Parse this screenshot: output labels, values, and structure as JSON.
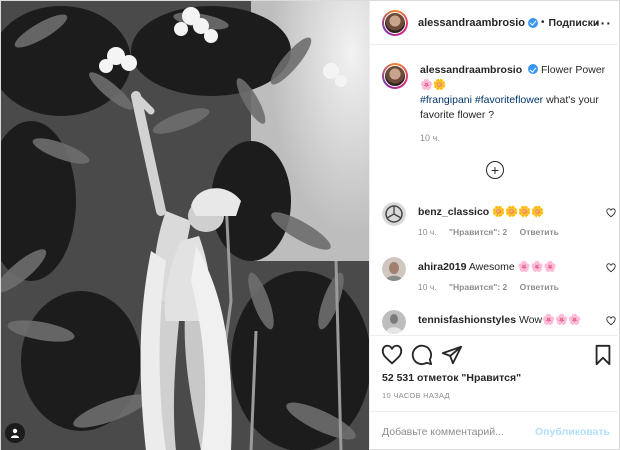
{
  "post": {
    "author": "alessandraambrosio",
    "header_separator": "•",
    "follow_label": "Подписки",
    "more_icon": "more-horizontal-icon",
    "image_alt": "Black and white photo of a woman reaching up to frangipani flowers"
  },
  "caption": {
    "user": "alessandraambrosio",
    "text_line1": "Flower Power",
    "emojis": "🌸🌼",
    "hashtag1": "#frangipani",
    "hashtag2": "#favoriteflower",
    "text_line2": "what's your favorite flower ?",
    "time": "10 ч."
  },
  "load_more_icon": "plus-circle-icon",
  "comments": [
    {
      "user": "benz_classico",
      "text": "🌼🌼🌼🌼",
      "time": "10 ч.",
      "likes": "\"Нравится\": 2",
      "reply": "Ответить"
    },
    {
      "user": "ahira2019",
      "text": "Awesome 🌸🌸🌸",
      "time": "10 ч.",
      "likes": "\"Нравится\": 2",
      "reply": "Ответить"
    },
    {
      "user": "tennisfashionstyles",
      "text": "Wow🌸🌸🌸",
      "time": "",
      "likes": "",
      "reply": ""
    }
  ],
  "actions": {
    "like_icon": "heart-icon",
    "comment_icon": "comment-icon",
    "share_icon": "share-icon",
    "save_icon": "bookmark-icon",
    "likes_text": "52 531 отметок \"Нравится\"",
    "time_ago": "10 ЧАСОВ НАЗАД"
  },
  "comment_input": {
    "placeholder": "Добавьте комментарий...",
    "publish_label": "Опубликовать"
  },
  "colors": {
    "link": "#003569",
    "verified": "#3897f0",
    "publish_disabled": "#b2dffc",
    "muted": "#8e8e8e"
  }
}
